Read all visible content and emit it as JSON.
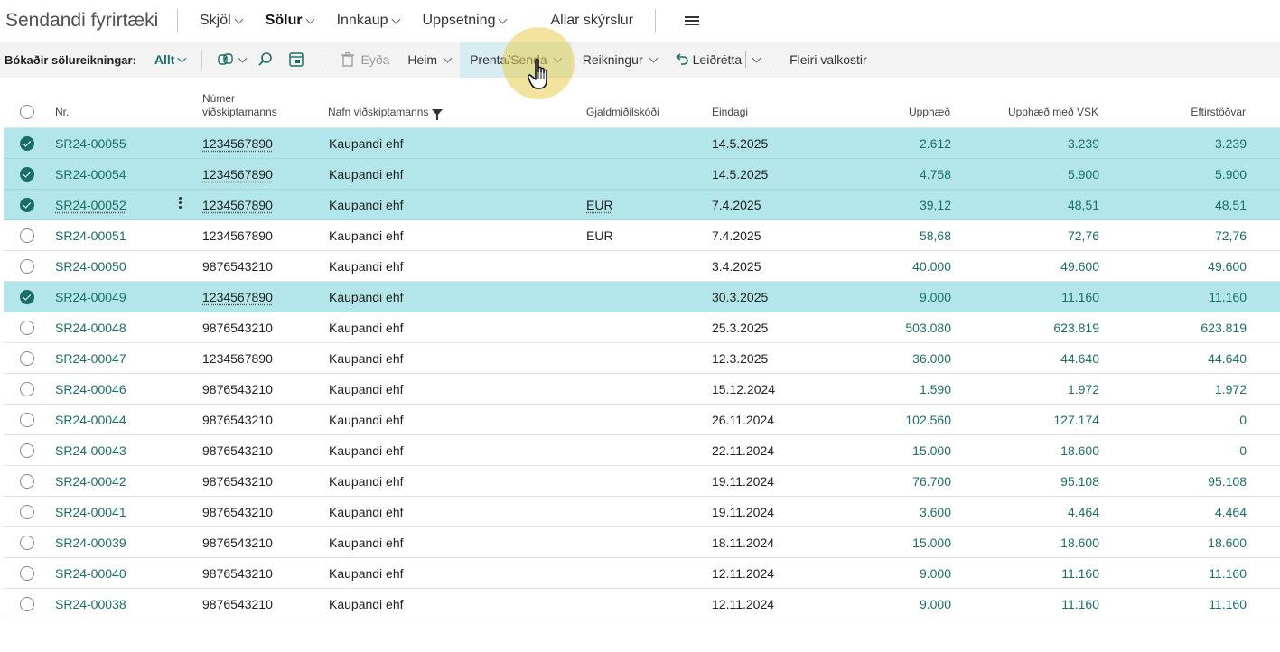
{
  "nav": {
    "app_title": "Sendandi fyrirtæki",
    "items": [
      {
        "label": "Skjöl"
      },
      {
        "label": "Sölur"
      },
      {
        "label": "Innkaup"
      },
      {
        "label": "Uppsetning"
      }
    ],
    "all_reports": "Allar skýrslur"
  },
  "actionbar": {
    "label": "Bókaðir sölureikningar:",
    "filter": "Allt",
    "delete": "Eyða",
    "home": "Heim",
    "print_send": "Prenta/Senda",
    "invoice": "Reikningur",
    "correct": "Leiðrétta",
    "more": "Fleiri valkostir"
  },
  "table": {
    "headers": {
      "no": "Nr.",
      "customer_no_1": "Númer",
      "customer_no_2": "viðskiptamanns",
      "customer_name": "Nafn viðskiptamanns",
      "currency": "Gjaldmiðilskóði",
      "due_date": "Eindagi",
      "amount": "Upphæð",
      "amount_vat": "Upphæð með VSK",
      "remaining": "Eftirstöðvar"
    },
    "rows": [
      {
        "no": "SR24-00055",
        "cust": "1234567890",
        "name": "Kaupandi ehf",
        "cur": "",
        "due": "14.5.2025",
        "amt": "2.612",
        "vat": "3.239",
        "rem": "3.239",
        "selected": true
      },
      {
        "no": "SR24-00054",
        "cust": "1234567890",
        "name": "Kaupandi ehf",
        "cur": "",
        "due": "14.5.2025",
        "amt": "4.758",
        "vat": "5.900",
        "rem": "5.900",
        "selected": true
      },
      {
        "no": "SR24-00052",
        "cust": "1234567890",
        "name": "Kaupandi ehf",
        "cur": "EUR",
        "due": "7.4.2025",
        "amt": "39,12",
        "vat": "48,51",
        "rem": "48,51",
        "selected": true,
        "current": true
      },
      {
        "no": "SR24-00051",
        "cust": "1234567890",
        "name": "Kaupandi ehf",
        "cur": "EUR",
        "due": "7.4.2025",
        "amt": "58,68",
        "vat": "72,76",
        "rem": "72,76",
        "selected": false
      },
      {
        "no": "SR24-00050",
        "cust": "9876543210",
        "name": "Kaupandi ehf",
        "cur": "",
        "due": "3.4.2025",
        "amt": "40.000",
        "vat": "49.600",
        "rem": "49.600",
        "selected": false
      },
      {
        "no": "SR24-00049",
        "cust": "1234567890",
        "name": "Kaupandi ehf",
        "cur": "",
        "due": "30.3.2025",
        "amt": "9.000",
        "vat": "11.160",
        "rem": "11.160",
        "selected": true
      },
      {
        "no": "SR24-00048",
        "cust": "9876543210",
        "name": "Kaupandi ehf",
        "cur": "",
        "due": "25.3.2025",
        "amt": "503.080",
        "vat": "623.819",
        "rem": "623.819",
        "selected": false
      },
      {
        "no": "SR24-00047",
        "cust": "1234567890",
        "name": "Kaupandi ehf",
        "cur": "",
        "due": "12.3.2025",
        "amt": "36.000",
        "vat": "44.640",
        "rem": "44.640",
        "selected": false
      },
      {
        "no": "SR24-00046",
        "cust": "9876543210",
        "name": "Kaupandi ehf",
        "cur": "",
        "due": "15.12.2024",
        "amt": "1.590",
        "vat": "1.972",
        "rem": "1.972",
        "selected": false
      },
      {
        "no": "SR24-00044",
        "cust": "9876543210",
        "name": "Kaupandi ehf",
        "cur": "",
        "due": "26.11.2024",
        "amt": "102.560",
        "vat": "127.174",
        "rem": "0",
        "selected": false
      },
      {
        "no": "SR24-00043",
        "cust": "9876543210",
        "name": "Kaupandi ehf",
        "cur": "",
        "due": "22.11.2024",
        "amt": "15.000",
        "vat": "18.600",
        "rem": "0",
        "selected": false
      },
      {
        "no": "SR24-00042",
        "cust": "9876543210",
        "name": "Kaupandi ehf",
        "cur": "",
        "due": "19.11.2024",
        "amt": "76.700",
        "vat": "95.108",
        "rem": "95.108",
        "selected": false
      },
      {
        "no": "SR24-00041",
        "cust": "9876543210",
        "name": "Kaupandi ehf",
        "cur": "",
        "due": "19.11.2024",
        "amt": "3.600",
        "vat": "4.464",
        "rem": "4.464",
        "selected": false
      },
      {
        "no": "SR24-00039",
        "cust": "9876543210",
        "name": "Kaupandi ehf",
        "cur": "",
        "due": "18.11.2024",
        "amt": "15.000",
        "vat": "18.600",
        "rem": "18.600",
        "selected": false
      },
      {
        "no": "SR24-00040",
        "cust": "9876543210",
        "name": "Kaupandi ehf",
        "cur": "",
        "due": "12.11.2024",
        "amt": "9.000",
        "vat": "11.160",
        "rem": "11.160",
        "selected": false
      },
      {
        "no": "SR24-00038",
        "cust": "9876543210",
        "name": "Kaupandi ehf",
        "cur": "",
        "due": "12.11.2024",
        "amt": "9.000",
        "vat": "11.160",
        "rem": "11.160",
        "selected": false
      }
    ]
  },
  "colors": {
    "accent": "#1a6e68",
    "selected_row": "#b2e6ea",
    "highlight": "#e8cd50"
  }
}
